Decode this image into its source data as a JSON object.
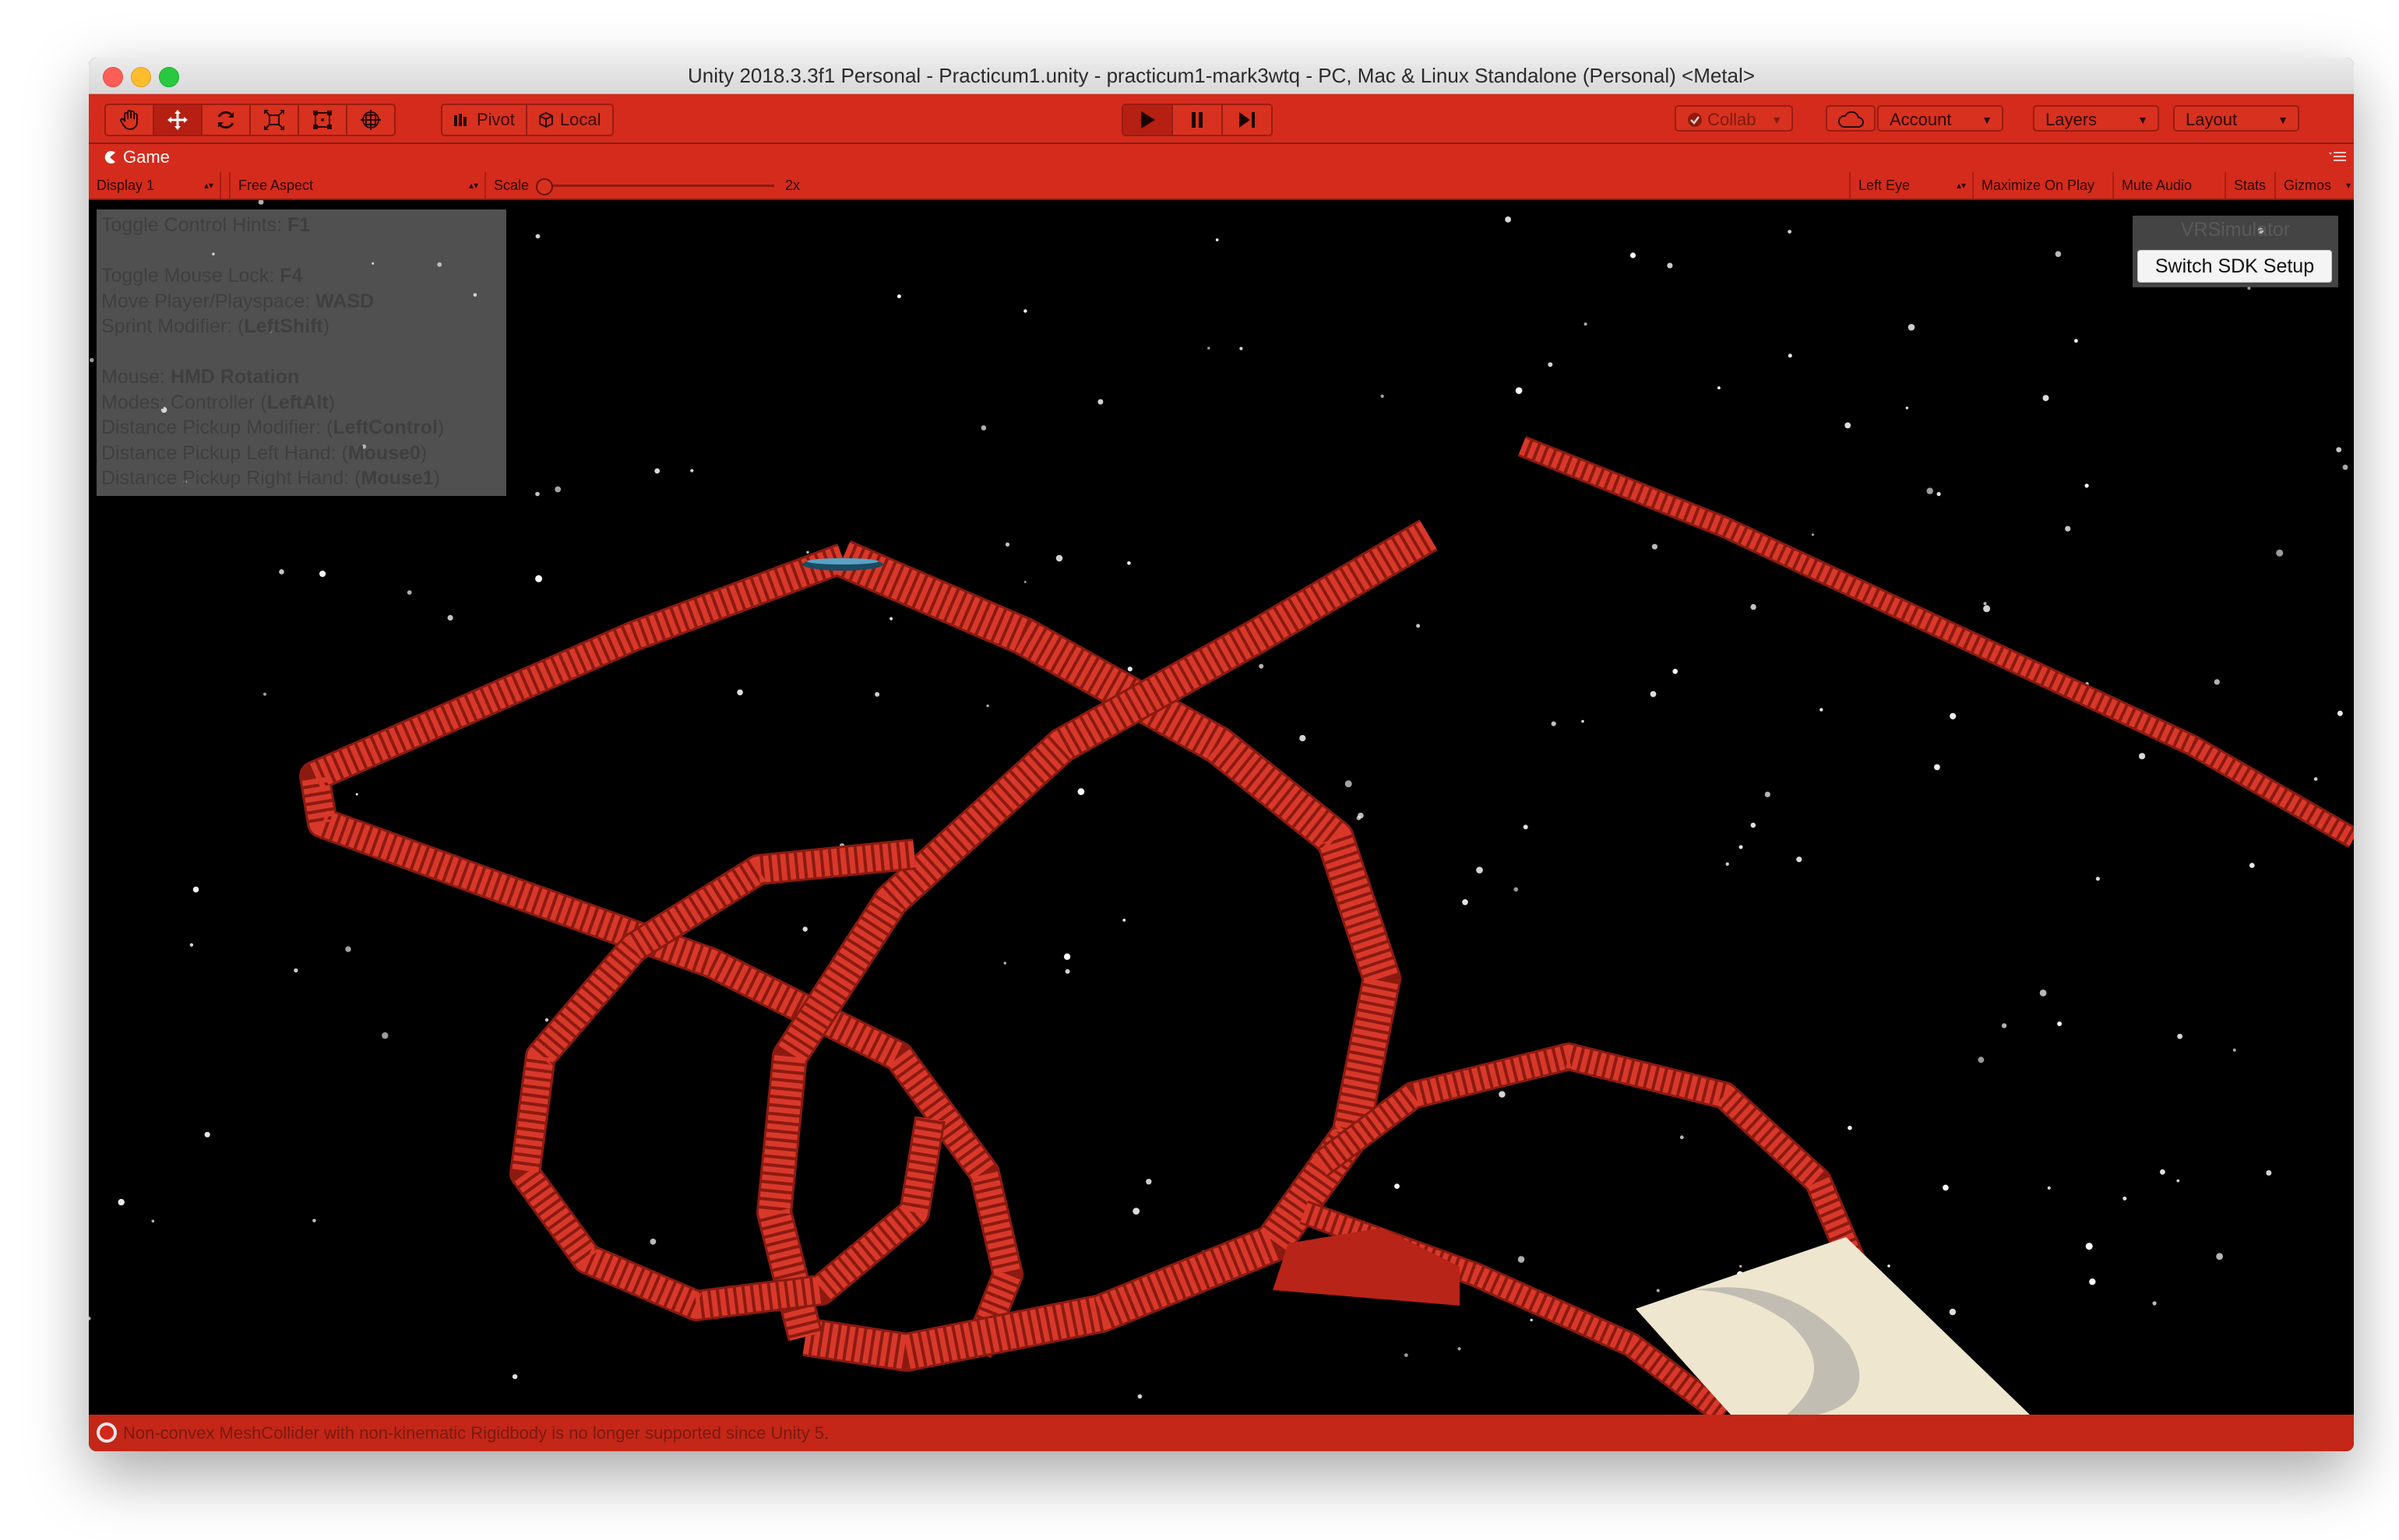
{
  "window": {
    "title": "Unity 2018.3.3f1 Personal - Practicum1.unity - practicum1-mark3wtq - PC, Mac & Linux Standalone (Personal) <Metal>"
  },
  "toolbar": {
    "tools": [
      "hand-icon",
      "move-icon",
      "rotate-icon",
      "scale-icon",
      "rect-icon",
      "transform-icon"
    ],
    "pivot_label": "Pivot",
    "local_label": "Local",
    "collab_label": "Collab",
    "account_label": "Account",
    "layers_label": "Layers",
    "layout_label": "Layout"
  },
  "game_view": {
    "tab_label": "Game",
    "display_label": "Display 1",
    "aspect_label": "Free Aspect",
    "scale_label": "Scale",
    "scale_value": "2x",
    "eye_label": "Left Eye",
    "maximize_label": "Maximize On Play",
    "mute_label": "Mute Audio",
    "stats_label": "Stats",
    "gizmos_label": "Gizmos"
  },
  "hints": [
    {
      "text": "Toggle Control Hints: ",
      "key": "F1"
    },
    {
      "text": "",
      "key": ""
    },
    {
      "text": "Toggle Mouse Lock: ",
      "key": "F4"
    },
    {
      "text": "Move Player/Playspace: ",
      "key": "WASD"
    },
    {
      "text": "Sprint Modifier: (",
      "key": "LeftShift",
      "suffix": ")"
    },
    {
      "text": "",
      "key": ""
    },
    {
      "text": "Mouse: ",
      "key": "HMD Rotation"
    },
    {
      "text": "Modes: Controller (",
      "key": "LeftAlt",
      "suffix": ")"
    },
    {
      "text": "Distance Pickup Modifier: (",
      "key": "LeftControl",
      "suffix": ")"
    },
    {
      "text": "Distance Pickup Left Hand: (",
      "key": "Mouse0",
      "suffix": ")"
    },
    {
      "text": "Distance Pickup Right Hand: (",
      "key": "Mouse1",
      "suffix": ")"
    }
  ],
  "vr_simulator": {
    "title": "VRSimulator",
    "button_label": "Switch SDK Setup"
  },
  "status": {
    "message": "Non-convex MeshCollider with non-kinematic Rigidbody is no longer supported since Unity 5."
  },
  "colors": {
    "editor_tint": "#d42b1c",
    "stairs": "#d8382a",
    "platform": "#efe6cf"
  }
}
